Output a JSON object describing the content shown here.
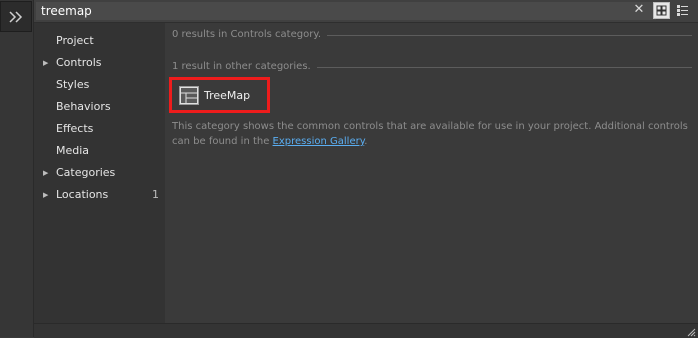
{
  "search": {
    "value": "treemap"
  },
  "toolbar": {
    "clear_icon": "close-icon",
    "grid_view_icon": "grid-view-icon",
    "list_view_icon": "list-view-icon",
    "expand_icon": "double-chevron-right-icon"
  },
  "sidebar": {
    "items": [
      {
        "label": "Project",
        "has_arrow": false,
        "count": ""
      },
      {
        "label": "Controls",
        "has_arrow": true,
        "count": ""
      },
      {
        "label": "Styles",
        "has_arrow": false,
        "count": ""
      },
      {
        "label": "Behaviors",
        "has_arrow": false,
        "count": ""
      },
      {
        "label": "Effects",
        "has_arrow": false,
        "count": ""
      },
      {
        "label": "Media",
        "has_arrow": false,
        "count": ""
      },
      {
        "label": "Categories",
        "has_arrow": true,
        "count": ""
      },
      {
        "label": "Locations",
        "has_arrow": true,
        "count": "1"
      }
    ],
    "selected_index": 1
  },
  "content": {
    "results_in_category": "0 results in Controls category.",
    "results_other": "1 result in other categories.",
    "result_tile": {
      "label": "TreeMap",
      "icon": "treemap-icon"
    },
    "description_text": "This category shows the common controls that are available for use in your project. Additional controls can be found in the ",
    "gallery_link": "Expression Gallery",
    "description_end": "."
  },
  "colors": {
    "background": "#3a3a3a",
    "sidebar": "#333333",
    "highlight_border": "#ee1c1c",
    "link": "#5aaef2"
  }
}
